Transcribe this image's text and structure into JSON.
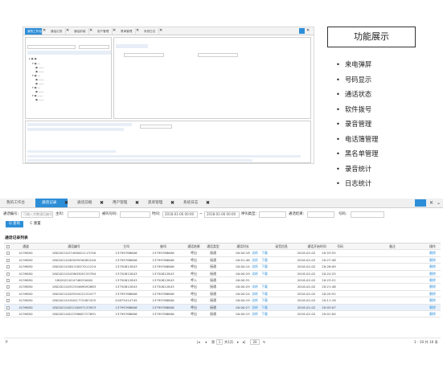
{
  "top_tabs": {
    "items": [
      "我的工作台",
      "通话记录",
      "通话前端",
      "用户管理",
      "黑单管理",
      "系统日志"
    ]
  },
  "feature_panel": {
    "title": "功能展示",
    "items": [
      "来电弹屏",
      "号码显示",
      "通话状态",
      "软件拨号",
      "录音管理",
      "电话簿管理",
      "黑名单管理",
      "录音统计",
      "日志统计"
    ]
  },
  "app": {
    "tabs": [
      "我的工作台",
      "通话记录",
      "通话前端",
      "用户管理",
      "黑单管理",
      "系统日志"
    ],
    "filters": {
      "call_id_label": "通话编号：",
      "call_id_placeholder": "可输入完整通话编号",
      "main_number_label": "主叫：",
      "called_number_label": "被叫号码：",
      "time_label": "时间：",
      "time_start": "2018-01-06 00:00",
      "time_to": "~",
      "time_end": "2018-01-06 00:00",
      "type_label": "呼叫类型：",
      "result_label": "通话结果：",
      "phone_label": "号码："
    },
    "query_button": "Q 查询",
    "reset_button": "C 重置",
    "section_title": "通话记录列表",
    "columns": [
      "通道",
      "通话编号",
      "主叫",
      "被叫",
      "通话结果",
      "通话类型",
      "通话时长",
      "",
      "录音信息",
      "通话开始时间",
      "",
      "号码",
      "备注",
      "操作"
    ],
    "rows": [
      [
        "4139650",
        "1802021027490001113740",
        "13799768606",
        "13799768606",
        "呼出",
        "接通",
        "00:00:18",
        "试听",
        "下载",
        "2018-02-02",
        "20:53:55",
        "",
        "",
        "删除"
      ],
      [
        "4139650",
        "1802021028505930082240",
        "13799768606",
        "13799768606",
        "呼出",
        "接通",
        "00:01:46",
        "试听",
        "下载",
        "2018-02-02",
        "20:27:48",
        "",
        "",
        "删除"
      ],
      [
        "4139650",
        "1802021028125027011224",
        "13750812843",
        "13799768606",
        "呼出",
        "接通",
        "00:00:14",
        "试听",
        "下载",
        "2018-02-02",
        "20:26:09",
        "",
        "",
        "删除"
      ],
      [
        "4139650",
        "1802021024580305155784",
        "13750812843",
        "13750812843",
        "呼出",
        "接通",
        "00:00:29",
        "试听",
        "下载",
        "2018-02-02",
        "20:24:25",
        "",
        "",
        "删除"
      ],
      [
        "4139650",
        "1802021024746250002",
        "13750812843",
        "13750812843",
        "呼入",
        "接通",
        "00:00:31",
        "",
        "",
        "2018-02-02",
        "20:23:21",
        "",
        "",
        "删除"
      ],
      [
        "4139650",
        "1802021025235469092883",
        "13750812843",
        "13750812843",
        "呼出",
        "接通",
        "00:00:29",
        "试听",
        "下载",
        "2018-02-02",
        "20:21:48",
        "",
        "",
        "删除"
      ],
      [
        "4139650",
        "1802021020555422152477",
        "13799768606",
        "13799768606",
        "呼出",
        "接通",
        "00:00:24",
        "试听",
        "下载",
        "2018-02-02",
        "20:20:52",
        "",
        "",
        "删除"
      ],
      [
        "4139650",
        "1802021019041772487425",
        "01875414745",
        "13799768606",
        "呼出",
        "接通",
        "00:00:19",
        "试听",
        "下载",
        "2018-02-02",
        "20:11:18",
        "",
        "",
        "删除"
      ],
      [
        "4139650",
        "1802021002210097133923",
        "13799768606",
        "13799768606",
        "呼出",
        "接通",
        "00:00:27",
        "试听",
        "下载",
        "2018-02-02",
        "20:03:07",
        "",
        "",
        "删除"
      ],
      [
        "4139650",
        "1802021001239662727691",
        "13799768606",
        "13799768606",
        "呼出",
        "接通",
        "00:00:15",
        "试听",
        "下载",
        "2018-02-02",
        "20:01:00",
        "",
        "",
        "删除"
      ]
    ],
    "pager": {
      "left": "P",
      "page_label_pre": "第",
      "page_value": "1",
      "page_label_post": "共1页",
      "page_size": "20",
      "summary": "1 - 10  共 10 条"
    }
  },
  "colors": {
    "accent": "#2d8ed8",
    "row_selected": "#e8f1fb"
  }
}
